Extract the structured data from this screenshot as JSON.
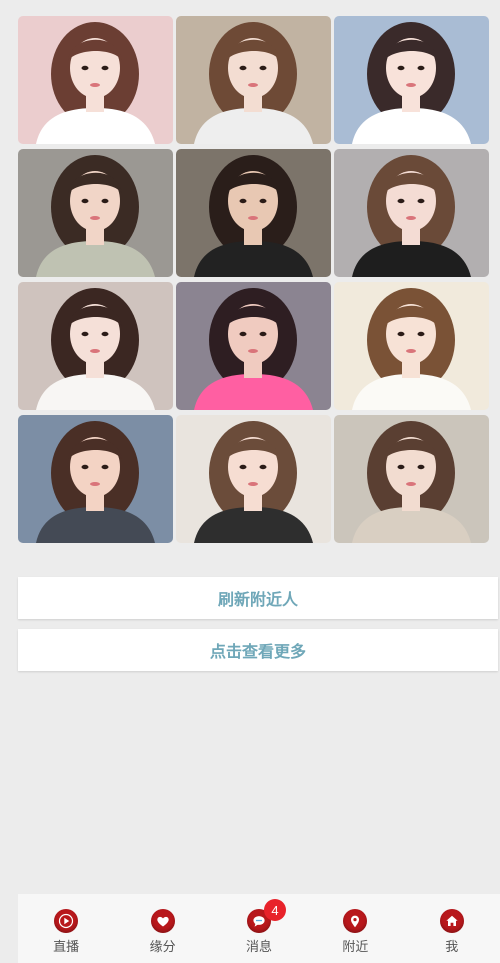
{
  "photos": [
    {
      "bg": "#e9c6c8",
      "hair": "#6b3e33",
      "skin": "#f6e0d8",
      "shirt": "#ffffff"
    },
    {
      "bg": "#b9a996",
      "hair": "#6e4a36",
      "skin": "#f3ddd2",
      "shirt": "#eeeeee"
    },
    {
      "bg": "#9eb3cf",
      "hair": "#3a2a2a",
      "skin": "#f8e2da",
      "shirt": "#ffffff"
    },
    {
      "bg": "#8e8a84",
      "hair": "#3b2b24",
      "skin": "#f1d5c7",
      "shirt": "#bfc2b2"
    },
    {
      "bg": "#6a6156",
      "hair": "#2a1e1a",
      "skin": "#e8c8b3",
      "shirt": "#222222"
    },
    {
      "bg": "#a8a4a6",
      "hair": "#6a4a38",
      "skin": "#f4dcd4",
      "shirt": "#1e1e1e"
    },
    {
      "bg": "#c9bbb5",
      "hair": "#3b2722",
      "skin": "#f5e0d8",
      "shirt": "#f8f6f4"
    },
    {
      "bg": "#7b7482",
      "hair": "#2e1e22",
      "skin": "#f0cbc0",
      "shirt": "#ff5fa2"
    },
    {
      "bg": "#efe7d8",
      "hair": "#7a5236",
      "skin": "#f7e2d6",
      "shirt": "#fbfaf6"
    },
    {
      "bg": "#6a7f99",
      "hair": "#4a2f26",
      "skin": "#f3d3c4",
      "shirt": "#444a55"
    },
    {
      "bg": "#e6e1da",
      "hair": "#6b4c3a",
      "skin": "#f6ddd2",
      "shirt": "#2e2e2e"
    },
    {
      "bg": "#c4bdb2",
      "hair": "#5a3f32",
      "skin": "#f2dcd0",
      "shirt": "#d9cfc2"
    }
  ],
  "buttons": {
    "refresh": "刷新附近人",
    "more": "点击查看更多"
  },
  "tabbar": {
    "tabs": [
      {
        "label": "直播",
        "icon": "play-icon"
      },
      {
        "label": "缘分",
        "icon": "heart-icon"
      },
      {
        "label": "消息",
        "icon": "chat-icon",
        "badge": "4"
      },
      {
        "label": "附近",
        "icon": "location-pin-icon"
      },
      {
        "label": "我",
        "icon": "home-icon"
      }
    ]
  },
  "colors": {
    "accent_text": "#6fa7b8",
    "icon_red": "#b8181c",
    "badge_red": "#e8222a"
  }
}
